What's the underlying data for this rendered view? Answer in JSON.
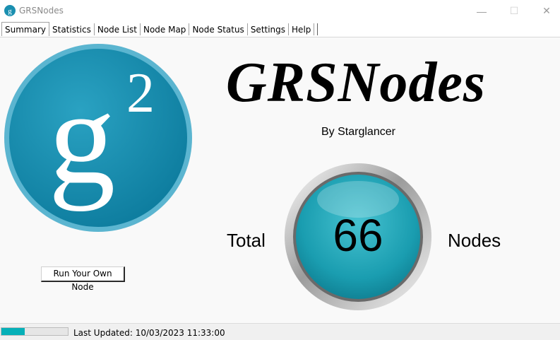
{
  "window": {
    "title": "GRSNodes",
    "minimize_glyph": "—",
    "maximize_glyph": "☐",
    "close_glyph": "✕"
  },
  "tabs": [
    {
      "label": "Summary",
      "active": true
    },
    {
      "label": "Statistics"
    },
    {
      "label": "Node List"
    },
    {
      "label": "Node Map"
    },
    {
      "label": "Node Status"
    },
    {
      "label": "Settings"
    },
    {
      "label": "Help"
    }
  ],
  "summary": {
    "app_name": "GRSNodes",
    "byline": "By Starglancer",
    "total_label": "Total",
    "node_count": "66",
    "nodes_label": "Nodes",
    "run_button_label": "Run Your Own Node",
    "logo_icon": "groestlcoin-g2-logo"
  },
  "status": {
    "progress_fraction": 0.35,
    "last_updated": "Last Updated: 10/03/2023 11:33:00"
  },
  "colors": {
    "logo_teal": "#1a8fb0",
    "gauge_teal": "#1fa8b8",
    "progress": "#06b0b8"
  }
}
